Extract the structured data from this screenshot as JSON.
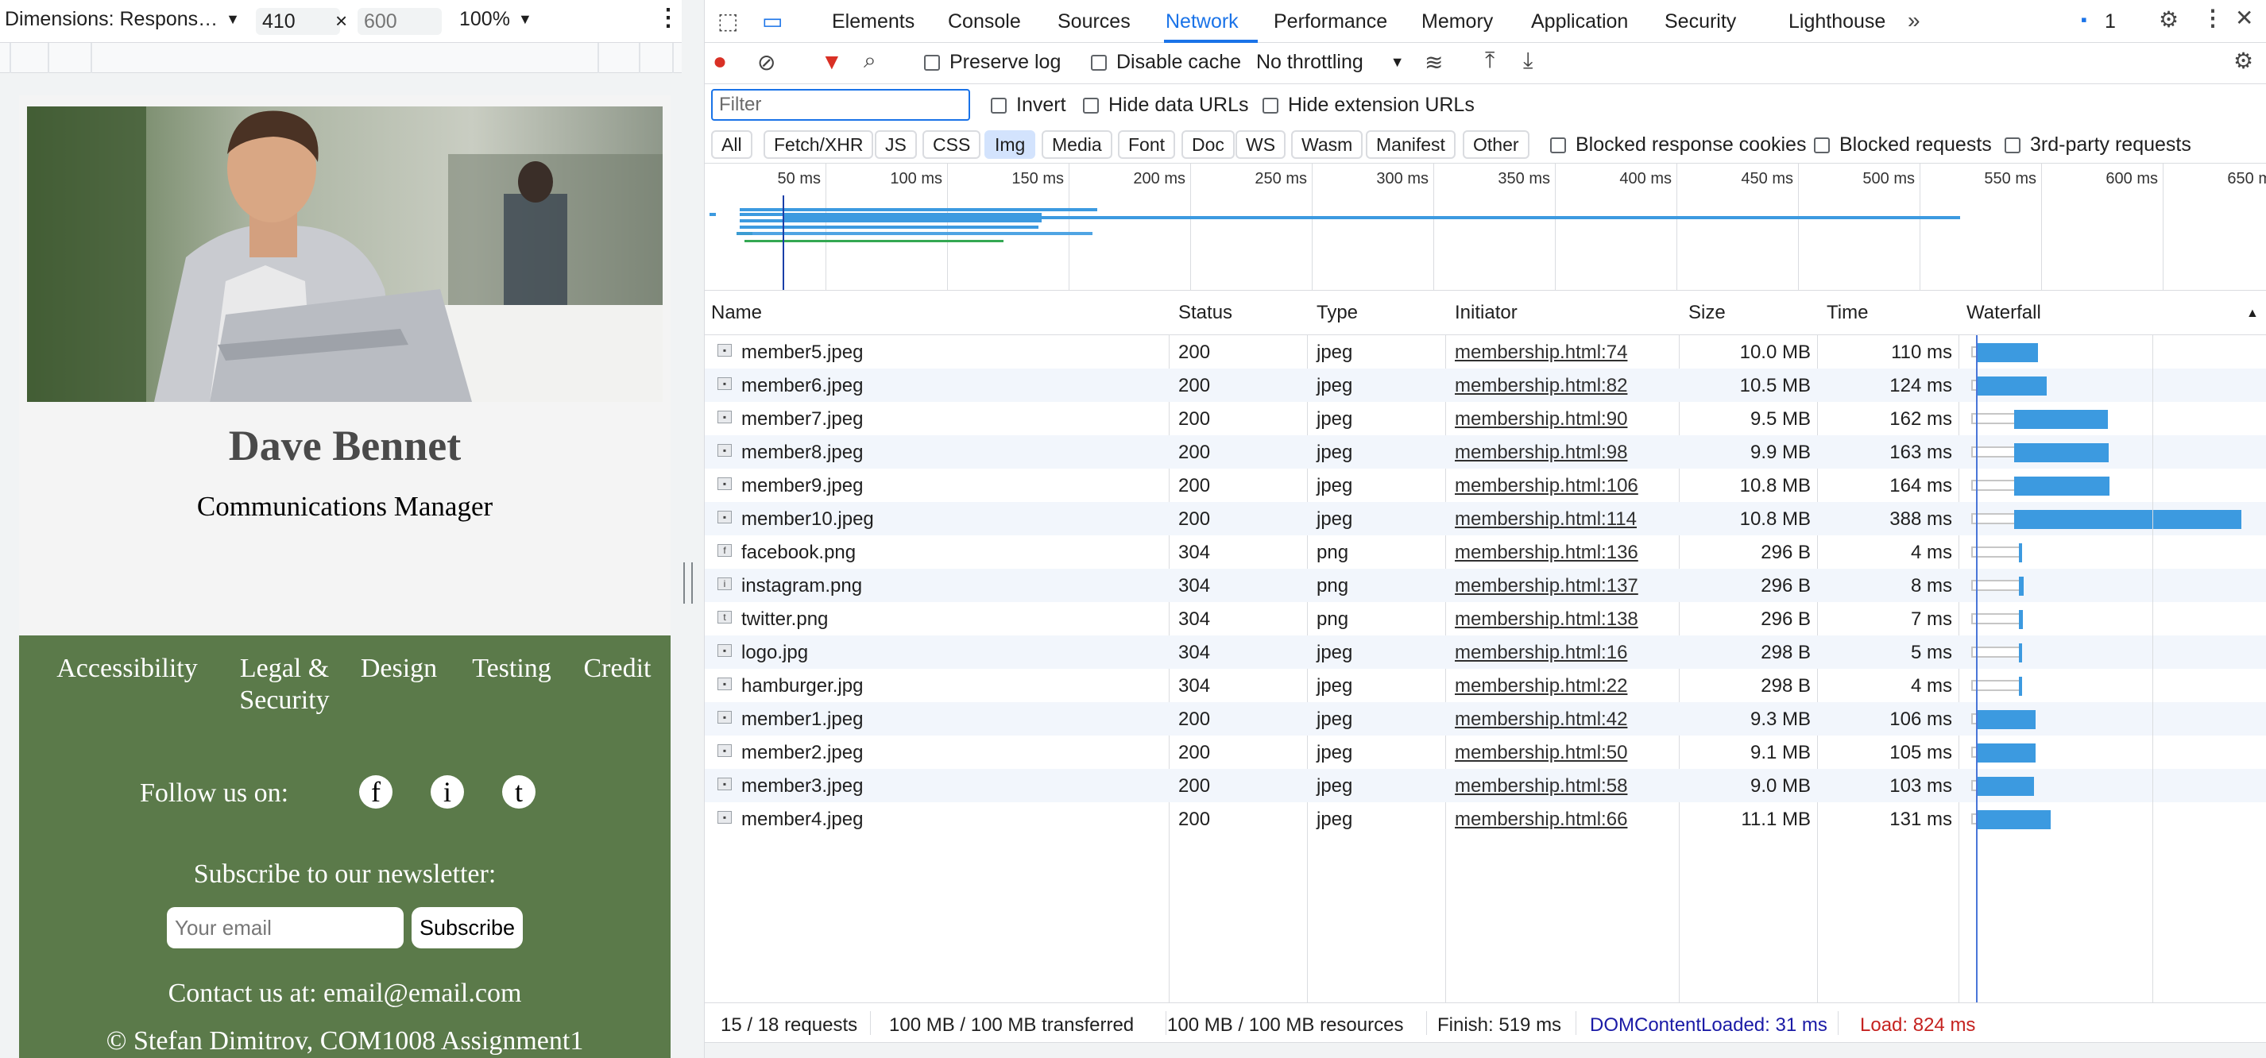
{
  "device_toolbar": {
    "dimensions_label": "Dimensions: Respons…",
    "width": "410",
    "height_placeholder": "600",
    "times": "×",
    "zoom": "100%"
  },
  "page": {
    "name": "Dave Bennet",
    "role": "Communications Manager",
    "footer_links": [
      "Accessibility",
      "Legal & Security",
      "Design",
      "Testing",
      "Credit"
    ],
    "follow_label": "Follow us on:",
    "social": [
      "f",
      "i",
      "t"
    ],
    "newsletter_label": "Subscribe to our newsletter:",
    "email_placeholder": "Your email",
    "subscribe_label": "Subscribe",
    "contact": "Contact us at: email@email.com",
    "copyright": "© Stefan Dimitrov, COM1008 Assignment1"
  },
  "devtools": {
    "tabs": [
      "Elements",
      "Console",
      "Sources",
      "Network",
      "Performance",
      "Memory",
      "Application",
      "Security",
      "Lighthouse"
    ],
    "active_tab": "Network",
    "issues_count": "1",
    "preserve_log": "Preserve log",
    "disable_cache": "Disable cache",
    "throttling": "No throttling",
    "filter_placeholder": "Filter",
    "invert": "Invert",
    "hide_data_urls": "Hide data URLs",
    "hide_extension_urls": "Hide extension URLs",
    "type_chips": [
      "All",
      "Fetch/XHR",
      "JS",
      "CSS",
      "Img",
      "Media",
      "Font",
      "Doc",
      "WS",
      "Wasm",
      "Manifest",
      "Other"
    ],
    "active_chip": "Img",
    "blocked_cookies": "Blocked response cookies",
    "blocked_requests": "Blocked requests",
    "third_party": "3rd-party requests",
    "overview_ticks": [
      "50 ms",
      "100 ms",
      "150 ms",
      "200 ms",
      "250 ms",
      "300 ms",
      "350 ms",
      "400 ms",
      "450 ms",
      "500 ms",
      "550 ms",
      "600 ms",
      "650 ms"
    ],
    "columns": [
      "Name",
      "Status",
      "Type",
      "Initiator",
      "Size",
      "Time",
      "Waterfall"
    ],
    "rows": [
      {
        "name": "member5.jpeg",
        "status": "200",
        "type": "jpeg",
        "initiator": "membership.html:74",
        "size": "10.0 MB",
        "time": "110 ms",
        "wait_ms": 4,
        "recv_ms": 106
      },
      {
        "name": "member6.jpeg",
        "status": "200",
        "type": "jpeg",
        "initiator": "membership.html:82",
        "size": "10.5 MB",
        "time": "124 ms",
        "wait_ms": 4,
        "recv_ms": 120
      },
      {
        "name": "member7.jpeg",
        "status": "200",
        "type": "jpeg",
        "initiator": "membership.html:90",
        "size": "9.5 MB",
        "time": "162 ms",
        "wait_ms": 2,
        "recv_ms": 160
      },
      {
        "name": "member8.jpeg",
        "status": "200",
        "type": "jpeg",
        "initiator": "membership.html:98",
        "size": "9.9 MB",
        "time": "163 ms",
        "wait_ms": 2,
        "recv_ms": 161
      },
      {
        "name": "member9.jpeg",
        "status": "200",
        "type": "jpeg",
        "initiator": "membership.html:106",
        "size": "10.8 MB",
        "time": "164 ms",
        "wait_ms": 2,
        "recv_ms": 162
      },
      {
        "name": "member10.jpeg",
        "status": "200",
        "type": "jpeg",
        "initiator": "membership.html:114",
        "size": "10.8 MB",
        "time": "388 ms",
        "wait_ms": 2,
        "recv_ms": 386
      },
      {
        "name": "facebook.png",
        "status": "304",
        "type": "png",
        "initiator": "membership.html:136",
        "size": "296 B",
        "time": "4 ms",
        "wait_ms": 1,
        "recv_ms": 3
      },
      {
        "name": "instagram.png",
        "status": "304",
        "type": "png",
        "initiator": "membership.html:137",
        "size": "296 B",
        "time": "8 ms",
        "wait_ms": 1,
        "recv_ms": 7
      },
      {
        "name": "twitter.png",
        "status": "304",
        "type": "png",
        "initiator": "membership.html:138",
        "size": "296 B",
        "time": "7 ms",
        "wait_ms": 1,
        "recv_ms": 6
      },
      {
        "name": "logo.jpg",
        "status": "304",
        "type": "jpeg",
        "initiator": "membership.html:16",
        "size": "298 B",
        "time": "5 ms",
        "wait_ms": 1,
        "recv_ms": 4
      },
      {
        "name": "hamburger.jpg",
        "status": "304",
        "type": "jpeg",
        "initiator": "membership.html:22",
        "size": "298 B",
        "time": "4 ms",
        "wait_ms": 1,
        "recv_ms": 3
      },
      {
        "name": "member1.jpeg",
        "status": "200",
        "type": "jpeg",
        "initiator": "membership.html:42",
        "size": "9.3 MB",
        "time": "106 ms",
        "wait_ms": 4,
        "recv_ms": 102
      },
      {
        "name": "member2.jpeg",
        "status": "200",
        "type": "jpeg",
        "initiator": "membership.html:50",
        "size": "9.1 MB",
        "time": "105 ms",
        "wait_ms": 4,
        "recv_ms": 101
      },
      {
        "name": "member3.jpeg",
        "status": "200",
        "type": "jpeg",
        "initiator": "membership.html:58",
        "size": "9.0 MB",
        "time": "103 ms",
        "wait_ms": 4,
        "recv_ms": 99
      },
      {
        "name": "member4.jpeg",
        "status": "200",
        "type": "jpeg",
        "initiator": "membership.html:66",
        "size": "11.1 MB",
        "time": "131 ms",
        "wait_ms": 4,
        "recv_ms": 127
      }
    ],
    "status": {
      "requests": "15 / 18 requests",
      "transferred": "100 MB / 100 MB transferred",
      "resources": "100 MB / 100 MB resources",
      "finish": "Finish: 519 ms",
      "dom": "DOMContentLoaded: 31 ms",
      "load": "Load: 824 ms"
    },
    "colors": {
      "accent": "#1a73e8",
      "waterfall_bar": "#3c9ae0",
      "dom_content_loaded": "#1a1aa6",
      "load": "#c5221f",
      "footer_green": "#5b7a4a"
    }
  }
}
